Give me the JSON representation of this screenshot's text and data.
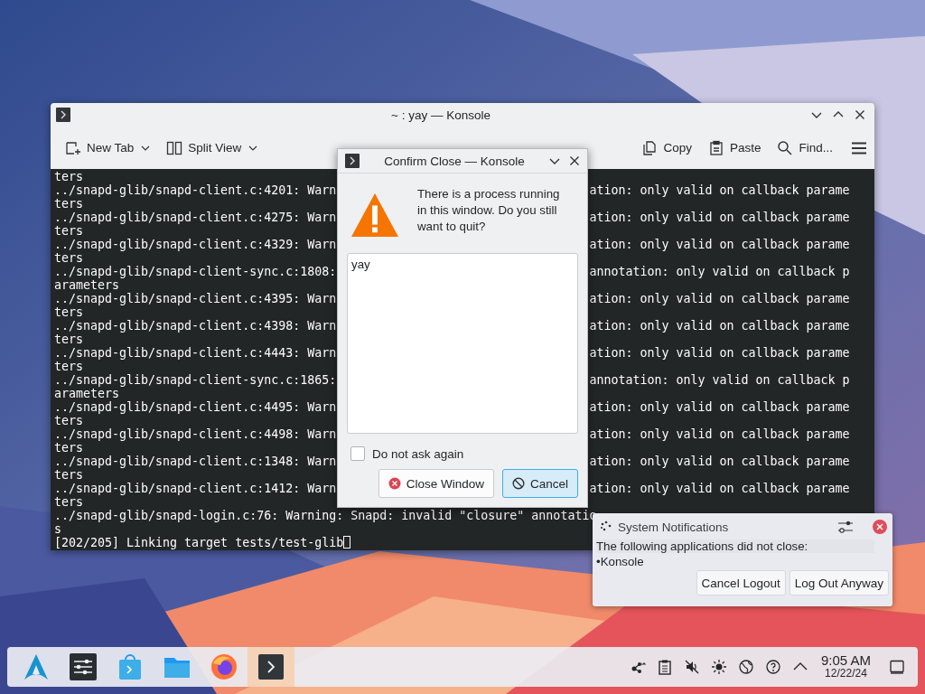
{
  "window": {
    "title": "~ : yay — Konsole",
    "toolbar": [
      {
        "label": "New Tab",
        "kind": "new-tab",
        "menu": true
      },
      {
        "label": "Split View",
        "kind": "split-view",
        "menu": true
      },
      {
        "label": "Copy",
        "kind": "copy",
        "menu": false
      },
      {
        "label": "Paste",
        "kind": "paste",
        "menu": false
      },
      {
        "label": "Find...",
        "kind": "find",
        "menu": false
      }
    ],
    "terminal": {
      "lines": [
        {
          "left": "ters"
        },
        {
          "left": "../snapd-glib/snapd-client.c:4201: Warn",
          "right": "ation: only valid on callback parame"
        },
        {
          "left": "ters"
        },
        {
          "left": "../snapd-glib/snapd-client.c:4275: Warn",
          "right": "ation: only valid on callback parame"
        },
        {
          "left": "ters"
        },
        {
          "left": "../snapd-glib/snapd-client.c:4329: Warn",
          "right": "ation: only valid on callback parame"
        },
        {
          "left": "ters"
        },
        {
          "left": "../snapd-glib/snapd-client-sync.c:1808:",
          "right": "annotation: only valid on callback p"
        },
        {
          "left": "arameters"
        },
        {
          "left": "../snapd-glib/snapd-client.c:4395: Warn",
          "right": "ation: only valid on callback parame"
        },
        {
          "left": "ters"
        },
        {
          "left": "../snapd-glib/snapd-client.c:4398: Warn",
          "right": "ation: only valid on callback parame"
        },
        {
          "left": "ters"
        },
        {
          "left": "../snapd-glib/snapd-client.c:4443: Warn",
          "right": "ation: only valid on callback parame"
        },
        {
          "left": "ters"
        },
        {
          "left": "../snapd-glib/snapd-client-sync.c:1865:",
          "right": "annotation: only valid on callback p"
        },
        {
          "left": "arameters"
        },
        {
          "left": "../snapd-glib/snapd-client.c:4495: Warn",
          "right": "ation: only valid on callback parame"
        },
        {
          "left": "ters"
        },
        {
          "left": "../snapd-glib/snapd-client.c:4498: Warn",
          "right": "ation: only valid on callback parame"
        },
        {
          "left": "ters"
        },
        {
          "left": "../snapd-glib/snapd-client.c:1348: Warn",
          "right": "ation: only valid on callback parame"
        },
        {
          "left": "ters"
        },
        {
          "left": "../snapd-glib/snapd-client.c:1412: Warn",
          "right": "ation: only valid on callback parame"
        },
        {
          "left": "ters"
        },
        {
          "left": "../snapd-glib/snapd-login.c:76: Warning: Snapd: invalid \"closure\" annotatio"
        },
        {
          "left": "s"
        }
      ],
      "prompt": "[202/205] Linking target tests/test-glib"
    }
  },
  "dialog": {
    "title": "Confirm Close — Konsole",
    "message": "There is a process running in this window. Do you still want to quit?",
    "processes": [
      "yay"
    ],
    "dont_ask": {
      "label": "Do not ask again",
      "checked": false
    },
    "buttons": [
      {
        "label": "Close Window",
        "kind": "close",
        "selected": false
      },
      {
        "label": "Cancel",
        "kind": "cancel",
        "selected": true
      }
    ]
  },
  "notification": {
    "app": "System Notifications",
    "message": "The following applications did not close:",
    "items": [
      "•Konsole"
    ],
    "buttons": [
      "Cancel Logout",
      "Log Out Anyway"
    ]
  },
  "taskbar": {
    "apps": [
      {
        "kind": "launcher",
        "active": false
      },
      {
        "kind": "settings",
        "active": false
      },
      {
        "kind": "store",
        "active": false
      },
      {
        "kind": "files",
        "active": false
      },
      {
        "kind": "browser",
        "active": false
      },
      {
        "kind": "terminal",
        "active": true
      }
    ],
    "clock": {
      "time": "9:05 AM",
      "date": "12/22/24"
    }
  }
}
